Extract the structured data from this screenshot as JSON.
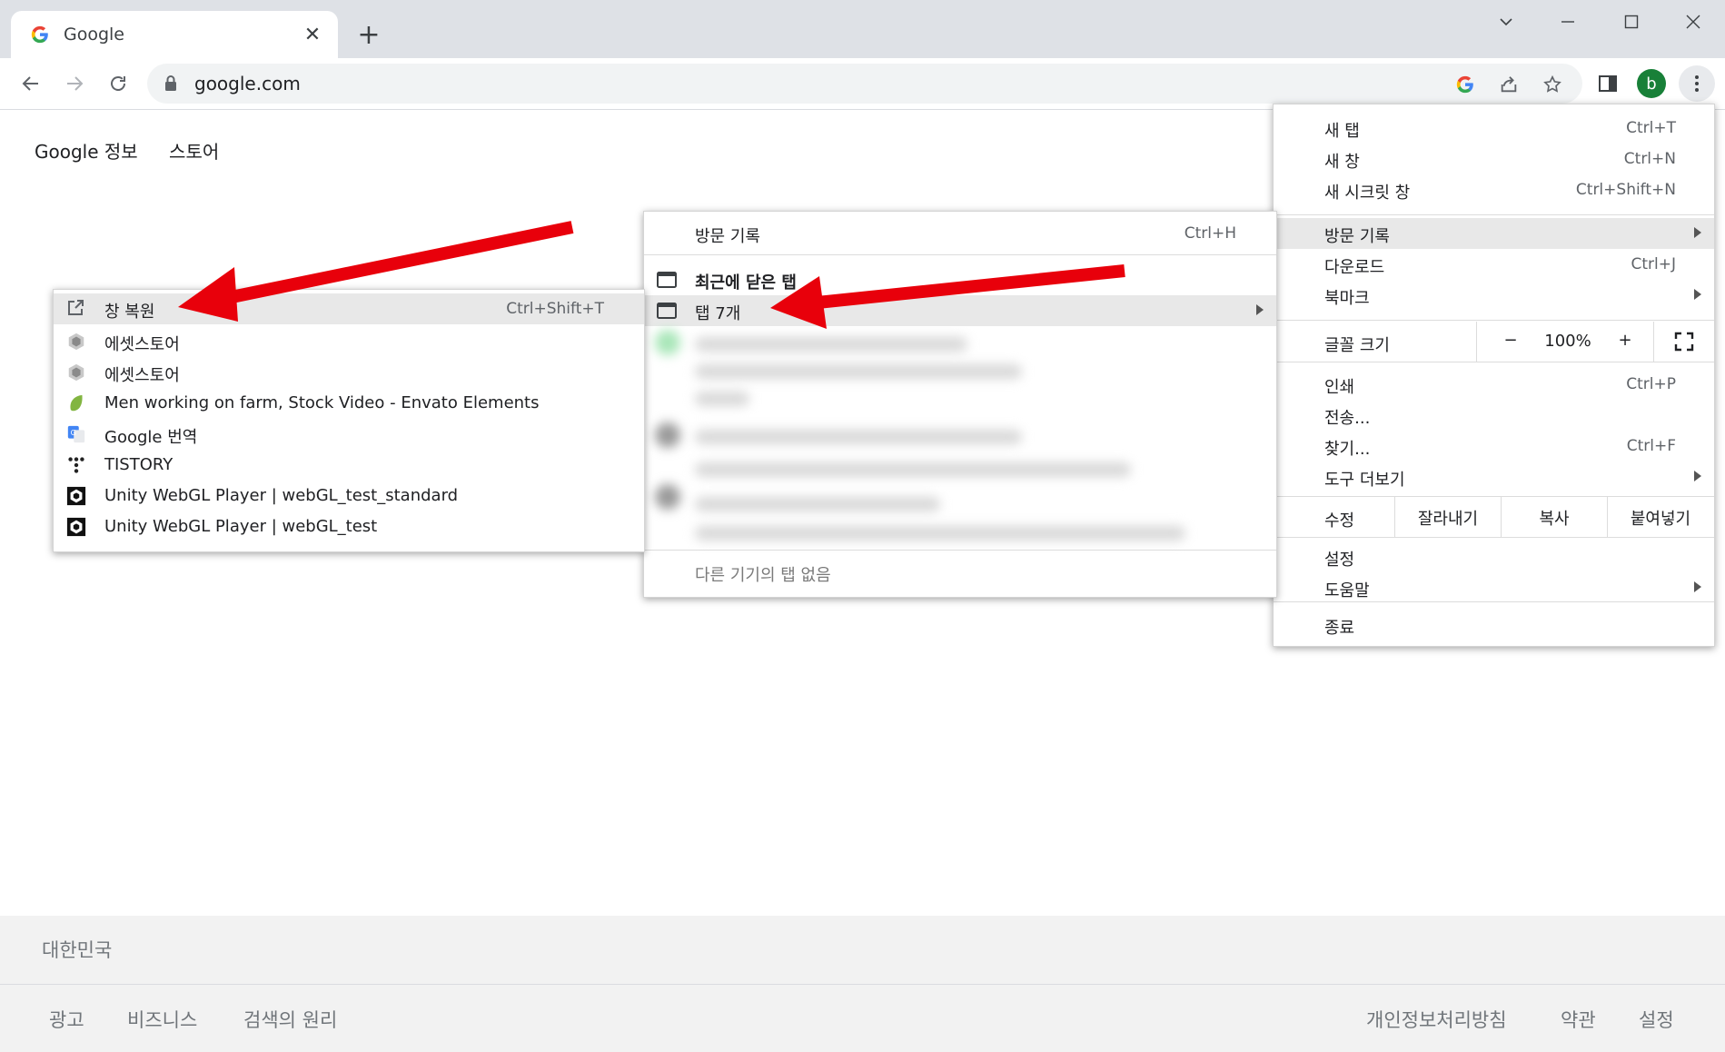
{
  "tab": {
    "title": "Google",
    "close_icon": "close-icon"
  },
  "address_bar": {
    "url": "google.com"
  },
  "avatar_letter": "b",
  "page": {
    "top_links": [
      "Google 정보",
      "스토어"
    ],
    "footer": {
      "country": "대한민국",
      "left_links": [
        "광고",
        "비즈니스",
        "검색의 원리"
      ],
      "right_links": [
        "개인정보처리방침",
        "약관",
        "설정"
      ]
    }
  },
  "main_menu": {
    "new_tab": {
      "label": "새 탭",
      "shortcut": "Ctrl+T"
    },
    "new_window": {
      "label": "새 창",
      "shortcut": "Ctrl+N"
    },
    "incognito": {
      "label": "새 시크릿 창",
      "shortcut": "Ctrl+Shift+N"
    },
    "history": {
      "label": "방문 기록"
    },
    "downloads": {
      "label": "다운로드",
      "shortcut": "Ctrl+J"
    },
    "bookmarks": {
      "label": "북마크"
    },
    "zoom": {
      "label": "글꼴 크기",
      "minus": "−",
      "value": "100%",
      "plus": "+"
    },
    "print": {
      "label": "인쇄",
      "shortcut": "Ctrl+P"
    },
    "cast": {
      "label": "전송..."
    },
    "find": {
      "label": "찾기...",
      "shortcut": "Ctrl+F"
    },
    "more_tools": {
      "label": "도구 더보기"
    },
    "edit": {
      "label": "수정",
      "cut": "잘라내기",
      "copy": "복사",
      "paste": "붙여넣기"
    },
    "settings": {
      "label": "설정"
    },
    "help": {
      "label": "도움말"
    },
    "exit": {
      "label": "종료"
    }
  },
  "history_menu": {
    "history": {
      "label": "방문 기록",
      "shortcut": "Ctrl+H"
    },
    "recently_closed": {
      "label": "최근에 닫은 탭"
    },
    "tabs_group": {
      "label": "탭 7개"
    },
    "no_other_devices": {
      "label": "다른 기기의 탭 없음"
    }
  },
  "tabs_submenu": {
    "restore": {
      "label": "창 복원",
      "shortcut": "Ctrl+Shift+T"
    },
    "items": [
      {
        "label": "에셋스토어",
        "icon": "unity-icon"
      },
      {
        "label": "에셋스토어",
        "icon": "unity-icon"
      },
      {
        "label": "Men working on farm, Stock Video - Envato Elements",
        "icon": "envato-leaf-icon"
      },
      {
        "label": "Google 번역",
        "icon": "google-translate-icon"
      },
      {
        "label": "TISTORY",
        "icon": "tistory-icon"
      },
      {
        "label": "Unity WebGL Player | webGL_test_standard",
        "icon": "unity-icon"
      },
      {
        "label": "Unity WebGL Player | webGL_test",
        "icon": "unity-icon"
      }
    ]
  },
  "colors": {
    "annotation_arrow": "#e8000b",
    "avatar": "#188038"
  }
}
